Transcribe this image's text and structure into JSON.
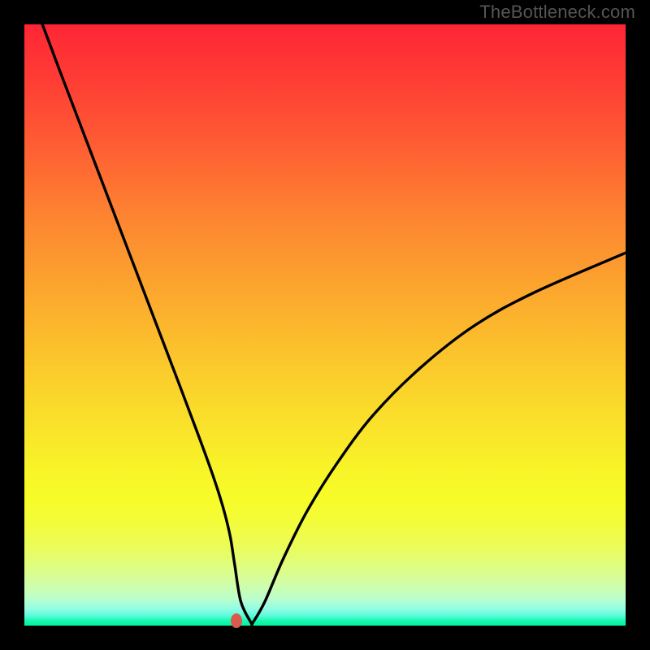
{
  "attribution": "TheBottleneck.com",
  "colors": {
    "background": "#000000",
    "curve": "#000000",
    "dot": "#d85b4e",
    "gradient_top": "#fd2635",
    "gradient_bottom": "#01f59a"
  },
  "chart_data": {
    "type": "line",
    "title": "",
    "xlabel": "",
    "ylabel": "",
    "xlim": [
      0,
      100
    ],
    "ylim": [
      0,
      100
    ],
    "grid": false,
    "legend": false,
    "series": [
      {
        "name": "curve",
        "x": [
          3,
          6,
          10,
          14,
          18,
          22,
          26,
          29,
          31,
          32.5,
          33.5,
          34.3,
          35,
          36,
          37.7,
          38,
          40,
          43,
          47,
          52,
          58,
          66,
          75,
          85,
          100
        ],
        "values": [
          100,
          92,
          81.5,
          71,
          60.5,
          50,
          39.5,
          31.5,
          26,
          21.5,
          18,
          14.5,
          10,
          4,
          0.5,
          0.5,
          4,
          11,
          19,
          27,
          35,
          43,
          50,
          55.5,
          62
        ]
      }
    ],
    "marker": {
      "x": 35.3,
      "y": 0.8
    }
  }
}
